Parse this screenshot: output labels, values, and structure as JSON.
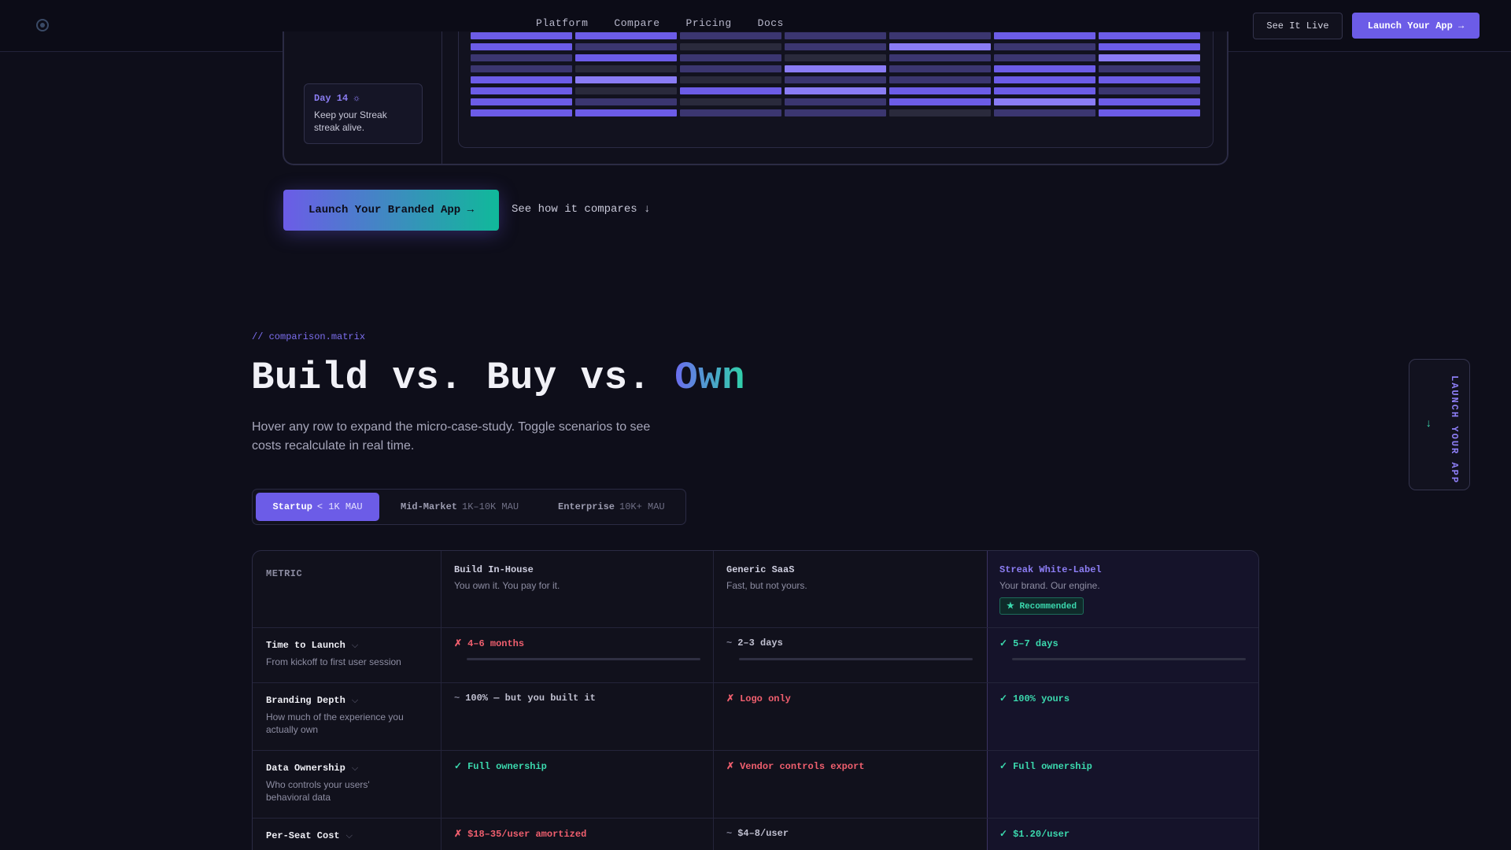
{
  "nav": {
    "links": [
      "Platform",
      "Compare",
      "Pricing",
      "Docs"
    ],
    "see_live": "See It Live",
    "launch": "Launch Your App →"
  },
  "preview": {
    "day_label": "Day 14 ☼",
    "day_message": "Keep your Streak streak alive."
  },
  "cta": {
    "primary": "Launch Your Branded App →",
    "secondary": "See how it compares ↓"
  },
  "section": {
    "kicker": "// comparison.matrix",
    "heading_part1": "Build vs. Buy vs. ",
    "heading_part2": "Own",
    "subtext": "Hover any row to expand the micro-case-study. Toggle scenarios to see costs recalculate in real time."
  },
  "tabs": [
    {
      "name": "Startup",
      "range": "< 1K MAU",
      "active": true
    },
    {
      "name": "Mid-Market",
      "range": "1K–10K MAU",
      "active": false
    },
    {
      "name": "Enterprise",
      "range": "10K+ MAU",
      "active": false
    }
  ],
  "table": {
    "metric_header": "METRIC",
    "columns": [
      {
        "title": "Build In-House",
        "subtitle": "You own it. You pay for it."
      },
      {
        "title": "Generic SaaS",
        "subtitle": "Fast, but not yours."
      },
      {
        "title": "Streak White-Label",
        "subtitle": "Your brand. Our engine.",
        "badge": "★ Recommended"
      }
    ],
    "rows": [
      {
        "metric": "Time to Launch",
        "desc": "From kickoff to first user session",
        "cells": [
          {
            "sym": "✗",
            "text": "4–6 months",
            "tone": "bad"
          },
          {
            "sym": "~",
            "text": "2–3 days",
            "tone": "mid"
          },
          {
            "sym": "✓",
            "text": "5–7 days",
            "tone": "good"
          }
        ]
      },
      {
        "metric": "Branding Depth",
        "desc": "How much of the experience you actually own",
        "cells": [
          {
            "sym": "~",
            "text": "100% — but you built it",
            "tone": "mid"
          },
          {
            "sym": "✗",
            "text": "Logo only",
            "tone": "bad"
          },
          {
            "sym": "✓",
            "text": "100% yours",
            "tone": "good"
          }
        ]
      },
      {
        "metric": "Data Ownership",
        "desc": "Who controls your users' behavioral data",
        "cells": [
          {
            "sym": "✓",
            "text": "Full ownership",
            "tone": "good"
          },
          {
            "sym": "✗",
            "text": "Vendor controls export",
            "tone": "bad"
          },
          {
            "sym": "✓",
            "text": "Full ownership",
            "tone": "good"
          }
        ]
      },
      {
        "metric": "Per-Seat Cost",
        "desc": "",
        "cells": [
          {
            "sym": "✗",
            "text": "$18–35/user amortized",
            "tone": "bad"
          },
          {
            "sym": "~",
            "text": "$4–8/user",
            "tone": "mid"
          },
          {
            "sym": "✓",
            "text": "$1.20/user",
            "tone": "good"
          }
        ]
      }
    ]
  },
  "side_launch": {
    "arrow": "↓",
    "label": "LAUNCH YOUR APP"
  },
  "colors": {
    "accent": "#6c5ce7",
    "good": "#3bd9ae",
    "bad": "#f05f6e",
    "background": "#0e0e1a"
  }
}
